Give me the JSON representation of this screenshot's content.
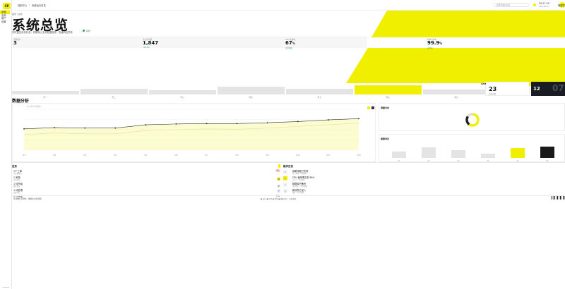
{
  "colors": {
    "accent": "#f1ef00",
    "dark": "#1a1c24",
    "success": "#1aa34a"
  },
  "sidebar": {
    "logo": "CP",
    "items": [
      {
        "label": "总览",
        "active": true
      },
      {
        "label": "应用",
        "active": false
      },
      {
        "label": "用户",
        "active": false
      },
      {
        "label": "设置",
        "active": false
      }
    ]
  },
  "topbar": {
    "breadcrumb_root": "控制中心",
    "breadcrumb_page": "系统运行总览",
    "search_placeholder": "搜索功能/应用",
    "time": "20:37:50",
    "date": "2024-05-21",
    "user": "管理员"
  },
  "page": {
    "crumb": "首页 / 总览",
    "title": "系统总览",
    "subtitle": "实时监控系统状态，洞察核心业务数据趋势，快速响应异常",
    "live_label": "实时"
  },
  "stats": [
    {
      "label": "活跃用户",
      "value": "3",
      "unit": "",
      "delta": ""
    },
    {
      "label": "今日访问量",
      "value": "1,847",
      "unit": "",
      "delta": "+12.5%"
    },
    {
      "label": "CPU 使用率",
      "value": "67",
      "unit": "%",
      "delta": "正常范围"
    },
    {
      "label": "系统可用率",
      "value": "99.9",
      "unit": "%",
      "delta": "近30天"
    }
  ],
  "weekly_bars": {
    "labels": [
      "周一",
      "周二",
      "周三",
      "周四",
      "周五",
      "周六",
      "周日"
    ],
    "values": [
      0.35,
      0.55,
      0.4,
      0.75,
      0.6,
      0.95,
      0.5
    ],
    "highlight_index": 5
  },
  "kpi_card": {
    "tag": "LIVE",
    "value": "23",
    "label": "在线人数"
  },
  "dark_card": {
    "value": "12",
    "big": "07"
  },
  "trend": {
    "title": "数据分析",
    "meta": "近12周·访问趋势",
    "chart_data": {
      "type": "area",
      "x": [
        "W1",
        "W2",
        "W3",
        "W4",
        "W5",
        "W6",
        "W7",
        "W8",
        "W9",
        "W10",
        "W11",
        "W12"
      ],
      "series": [
        {
          "name": "",
          "values": [
            52,
            55,
            54,
            54,
            62,
            64,
            65,
            65,
            67,
            70,
            74,
            77
          ]
        },
        {
          "name": "",
          "values": [
            38,
            42,
            40,
            40,
            48,
            50,
            52,
            51,
            54,
            58,
            62,
            66
          ]
        }
      ],
      "ylim": [
        0,
        100
      ]
    }
  },
  "donut": {
    "title": "流量分布",
    "chart_data": {
      "type": "pie",
      "values": [
        60,
        25,
        15
      ]
    }
  },
  "mini_bars": {
    "title": "周期对比",
    "chart_data": {
      "type": "bar",
      "categories": [
        "01",
        "02",
        "03",
        "04",
        "05",
        "06"
      ],
      "values": [
        45,
        75,
        55,
        30,
        70,
        80
      ]
    }
  },
  "tasks": {
    "title": "任务",
    "items": [
      {
        "title": "1个工单",
        "sub": "待处理事项",
        "tag": "紧急"
      },
      {
        "title": "1 审核",
        "sub": "内容审核",
        "tag": "高"
      },
      {
        "title": "1 待升级",
        "sub": "版本更新",
        "tag": "中"
      },
      {
        "title": "1 待处理",
        "sub": "常规任务",
        "tag": "低"
      },
      {
        "title": "2 已完成",
        "sub": "今日归档",
        "tag": "已完"
      }
    ]
  },
  "logs": {
    "title": "操作日志",
    "items": [
      {
        "icon": "✓",
        "title": "部署流程已完成",
        "sub": "生产环境 · 2分钟前"
      },
      {
        "icon": "!",
        "title": "CPU 使用率达到 85%",
        "sub": "节点 A · 8分钟前"
      },
      {
        "icon": "i",
        "title": "数据库已备份",
        "sub": "自动任务 · 15分钟前"
      },
      {
        "icon": "○",
        "title": "新成员已加入",
        "sub": "团队 · 32分钟前"
      }
    ]
  },
  "footer": {
    "left": "© 2024 控制台 · 数据每30秒刷新",
    "legend": "● 运行   ● 正常   ● 警告   ● 故障   统计 · 实时更新"
  }
}
